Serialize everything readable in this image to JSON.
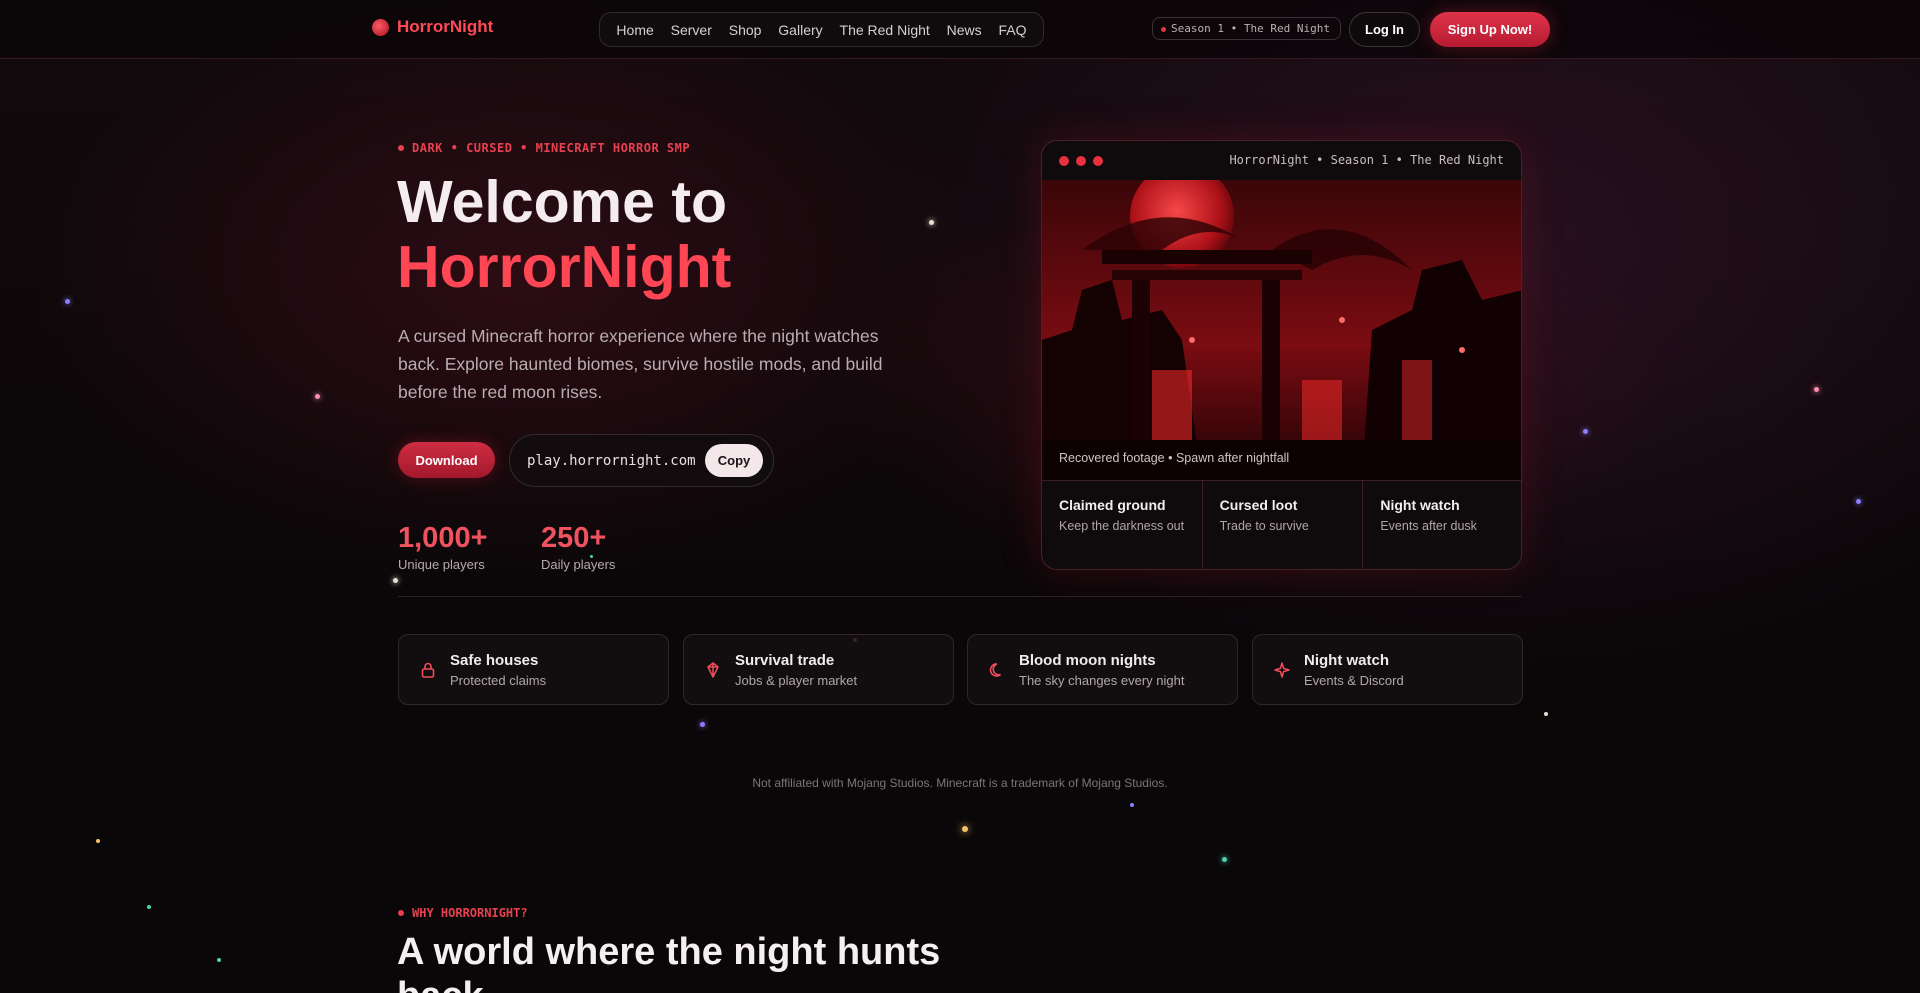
{
  "nav": {
    "brand": "HorrorNight",
    "links": [
      "Home",
      "Server",
      "Shop",
      "Gallery",
      "The Red Night",
      "News",
      "FAQ"
    ],
    "season": "Season 1 • The Red Night",
    "login": "Log In",
    "signup": "Sign Up Now!"
  },
  "hero": {
    "eyebrow": "DARK • CURSED • MINECRAFT HORROR SMP",
    "title_line1": "Welcome to",
    "title_line2": "HorrorNight",
    "subtitle": "A cursed Minecraft horror experience where the night watches back. Explore haunted biomes, survive hostile mods, and build before the red moon rises.",
    "download": "Download",
    "server_ip": "play.horrornight.com",
    "copy": "Copy",
    "stats": [
      {
        "value": "1,000+",
        "label": "Unique players"
      },
      {
        "value": "250+",
        "label": "Daily players"
      }
    ]
  },
  "card": {
    "caption_top": "HorrorNight • Season 1 • The Red Night",
    "footage_caption": "Recovered footage • Spawn after nightfall",
    "features": [
      {
        "title": "Claimed ground",
        "desc": "Keep the darkness out"
      },
      {
        "title": "Cursed loot",
        "desc": "Trade to survive"
      },
      {
        "title": "Night watch",
        "desc": "Events after dusk"
      }
    ]
  },
  "mini_cards": [
    {
      "icon": "lock-icon",
      "title": "Safe houses",
      "desc": "Protected claims"
    },
    {
      "icon": "gem-icon",
      "title": "Survival trade",
      "desc": "Jobs & player market"
    },
    {
      "icon": "moon-icon",
      "title": "Blood moon nights",
      "desc": "The sky changes every night"
    },
    {
      "icon": "sparkle-icon",
      "title": "Night watch",
      "desc": "Events & Discord"
    }
  ],
  "disclaimer": "Not affiliated with Mojang Studios. Minecraft is a trademark of Mojang Studios.",
  "why": {
    "eyebrow": "WHY HORRORNIGHT?",
    "title": "A world where the night hunts back"
  },
  "colors": {
    "accent": "#ff4654",
    "background": "#0b0709"
  }
}
